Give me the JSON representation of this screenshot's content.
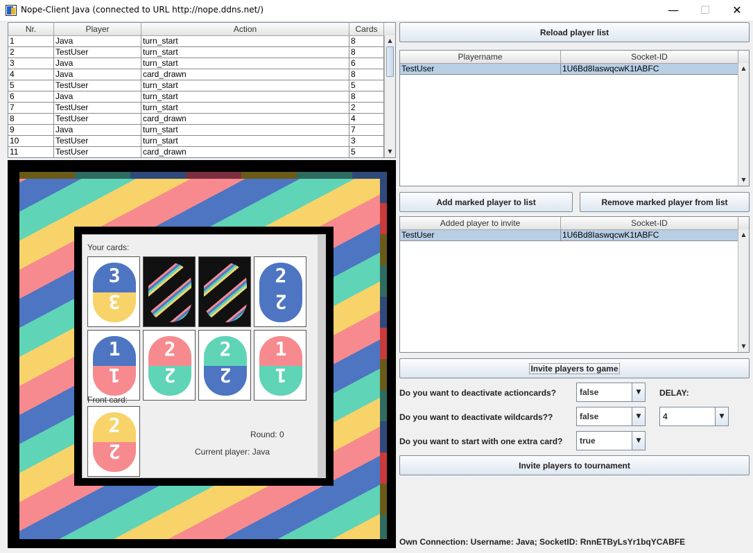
{
  "window": {
    "title": "Nope-Client Java (connected to URL http://nope.ddns.net/)",
    "controls": {
      "minimize": "—",
      "maximize": "☐",
      "close": "✕"
    }
  },
  "log_table": {
    "headers": [
      "Nr.",
      "Player",
      "Action",
      "Cards"
    ],
    "rows": [
      [
        "1",
        "Java",
        "turn_start",
        "8"
      ],
      [
        "2",
        "TestUser",
        "turn_start",
        "8"
      ],
      [
        "3",
        "Java",
        "turn_start",
        "6"
      ],
      [
        "4",
        "Java",
        "card_drawn",
        "8"
      ],
      [
        "5",
        "TestUser",
        "turn_start",
        "5"
      ],
      [
        "6",
        "Java",
        "turn_start",
        "8"
      ],
      [
        "7",
        "TestUser",
        "turn_start",
        "2"
      ],
      [
        "8",
        "TestUser",
        "card_drawn",
        "4"
      ],
      [
        "9",
        "Java",
        "turn_start",
        "7"
      ],
      [
        "10",
        "TestUser",
        "turn_start",
        "3"
      ],
      [
        "11",
        "TestUser",
        "card_drawn",
        "5"
      ]
    ]
  },
  "player_list": {
    "reload_button": "Reload player list",
    "headers": [
      "Playername",
      "Socket-ID"
    ],
    "rows": [
      [
        "TestUser",
        "1U6Bd8IaswqcwK1tABFC"
      ]
    ]
  },
  "actions": {
    "add_button": "Add marked player to list",
    "remove_button": "Remove marked player from list"
  },
  "invite_list": {
    "headers": [
      "Added player to invite",
      "Socket-ID"
    ],
    "rows": [
      [
        "TestUser",
        "1U6Bd8IaswqcwK1tABFC"
      ]
    ]
  },
  "invite_game_button": "Invite players to game",
  "options": {
    "deactivate_actioncards": {
      "label": "Do you want to deactivate actioncards?",
      "value": "false"
    },
    "deactivate_wildcards": {
      "label": "Do you want to deactivate wildcards??",
      "value": "false"
    },
    "extra_card": {
      "label": "Do you want to start with one extra card?",
      "value": "true"
    },
    "delay": {
      "label": "DELAY:",
      "value": "4"
    }
  },
  "invite_tournament_button": "Invite players to tournament",
  "status": "Own Connection: Username: Java; SocketID: RnnETByLsYr1bqYCABFE",
  "game": {
    "your_cards_label": "Your cards:",
    "front_card_label": "Front card:",
    "round_text": "Round: 0",
    "current_player_text": "Current player: Java",
    "hand": [
      {
        "top": "3",
        "bottom": "3",
        "colors": [
          "#4d75c2",
          "#f7d36a"
        ]
      },
      {
        "top": "",
        "bottom": "",
        "colors": [
          "#111111",
          "#111111"
        ],
        "kind": "action"
      },
      {
        "top": "",
        "bottom": "",
        "colors": [
          "#111111",
          "#111111"
        ],
        "kind": "action"
      },
      {
        "top": "2",
        "bottom": "2",
        "colors": [
          "#4d75c2",
          "#4d75c2"
        ]
      },
      {
        "top": "1",
        "bottom": "1",
        "colors": [
          "#4d75c2",
          "#f78a8f"
        ]
      },
      {
        "top": "2",
        "bottom": "2",
        "colors": [
          "#f78a8f",
          "#5fd4b6"
        ]
      },
      {
        "top": "2",
        "bottom": "2",
        "colors": [
          "#5fd4b6",
          "#4d75c2"
        ]
      },
      {
        "top": "1",
        "bottom": "1",
        "colors": [
          "#f78a8f",
          "#5fd4b6"
        ]
      }
    ],
    "front_card": {
      "top": "2",
      "bottom": "2",
      "colors": [
        "#f7d36a",
        "#f78a8f"
      ]
    }
  }
}
